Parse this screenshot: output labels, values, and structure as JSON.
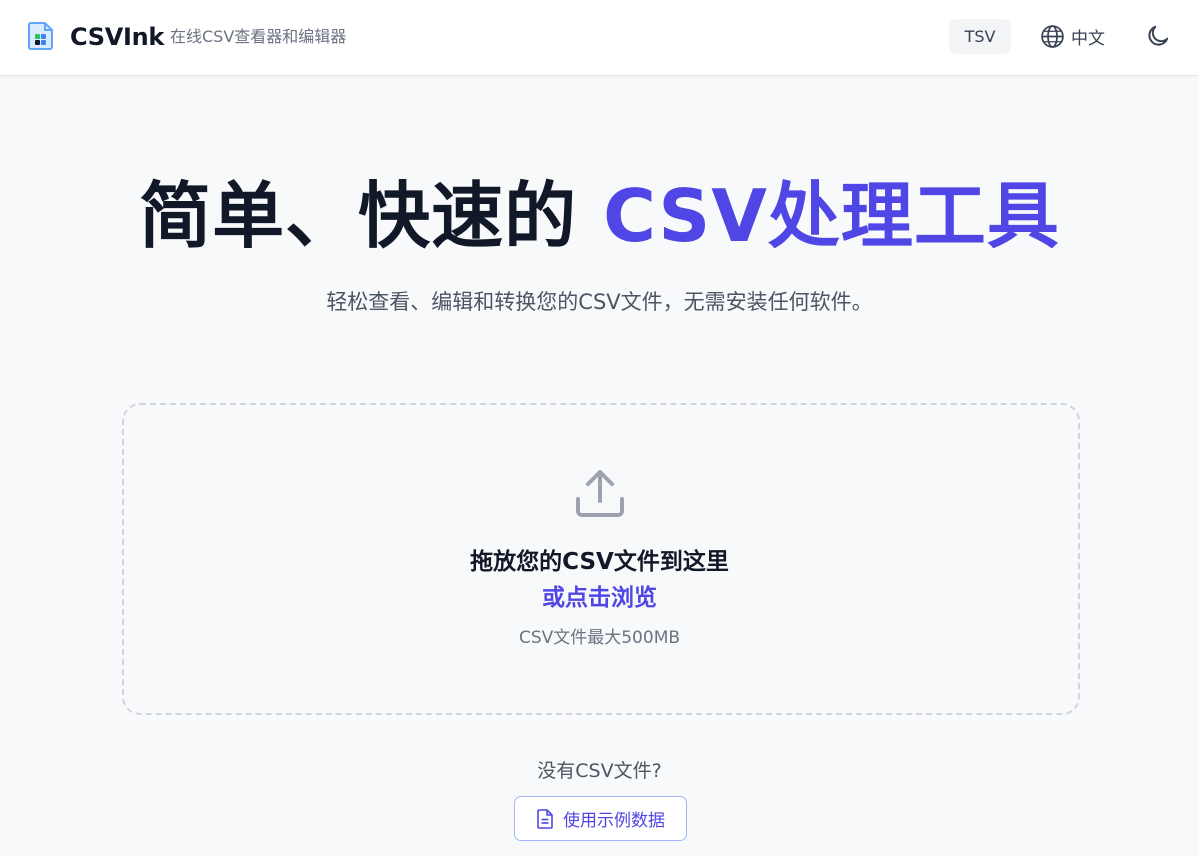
{
  "header": {
    "brand_name": "CSVInk",
    "tagline": "在线CSV查看器和编辑器",
    "tsv_label": "TSV",
    "language_label": "中文",
    "icons": {
      "logo": "csv-file-logo-icon",
      "language": "globe-icon",
      "theme": "moon-icon"
    }
  },
  "hero": {
    "title_dark": "简单、快速的 ",
    "title_accent": "CSV处理工具",
    "subtitle": "轻松查看、编辑和转换您的CSV文件，无需安装任何软件。"
  },
  "dropzone": {
    "icon": "upload-icon",
    "title": "拖放您的CSV文件到这里",
    "browse_label": "或点击浏览",
    "size_hint": "CSV文件最大500MB"
  },
  "sample": {
    "prompt": "没有CSV文件?",
    "button_label": "使用示例数据",
    "icon": "document-icon"
  },
  "colors": {
    "accent": "#4f46e5",
    "text_dark": "#111827",
    "text_muted": "#6b7280",
    "background": "#f8f9fb"
  }
}
